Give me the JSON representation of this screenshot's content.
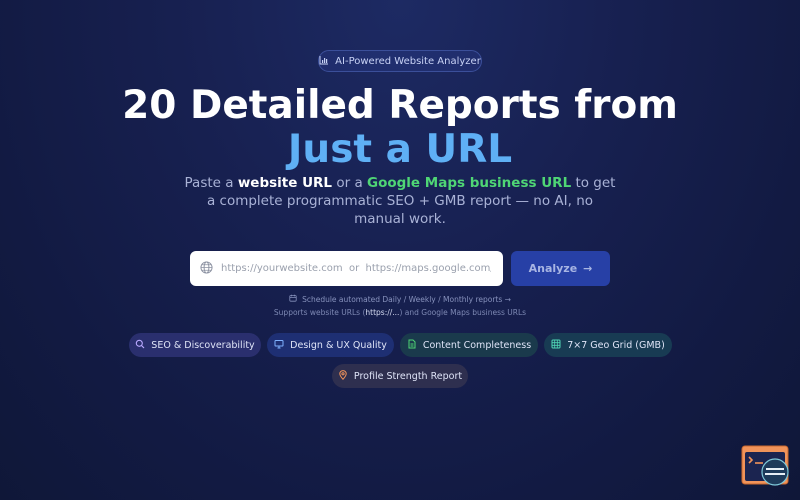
{
  "badge": {
    "label": "AI-Powered Website Analyzer"
  },
  "hero": {
    "title_main": "20 Detailed Reports from ",
    "title_accent": "Just a URL",
    "subtitle_p1": "Paste a ",
    "subtitle_b1": "website URL",
    "subtitle_p2": " or a ",
    "subtitle_b2": "Google Maps business URL",
    "subtitle_p3": " to get a complete programmatic SEO + GMB report — no AI, no manual work."
  },
  "search": {
    "placeholder": "https://yourwebsite.com  or  https://maps.google.com/maps/pl",
    "button_label": "Analyze",
    "button_arrow": "→"
  },
  "schedule_link": "Schedule automated Daily / Weekly / Monthly reports →",
  "supports": {
    "p1": "Supports website URLs (",
    "b1": "https://...",
    "p2": ") and Google Maps business URLs"
  },
  "chips": [
    {
      "label": "SEO & Discoverability",
      "icon": "search-icon",
      "color": "#b9a8ff"
    },
    {
      "label": "Design & UX Quality",
      "icon": "monitor-icon",
      "color": "#7fb2ff"
    },
    {
      "label": "Content Completeness",
      "icon": "document-icon",
      "color": "#4fd675"
    },
    {
      "label": "7×7 Geo Grid (GMB)",
      "icon": "grid-icon",
      "color": "#4fd6b5"
    },
    {
      "label": "Profile Strength Report",
      "icon": "location-pin-icon",
      "color": "#f0935a"
    }
  ],
  "colors": {
    "accent": "#5fb0f5",
    "green": "#4fd675",
    "button": "#2740a6",
    "background": "#172050"
  }
}
